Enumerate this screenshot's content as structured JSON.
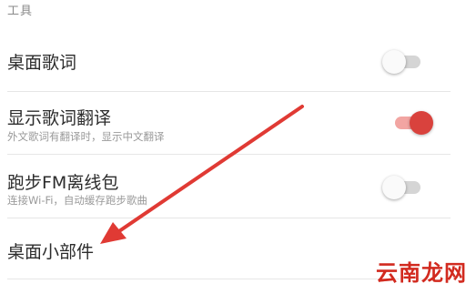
{
  "section": {
    "header": "工具"
  },
  "settings": {
    "desktop_lyrics": {
      "title": "桌面歌词",
      "enabled": false
    },
    "lyrics_translation": {
      "title": "显示歌词翻译",
      "subtitle": "外文歌词有翻译时，显示中文翻译",
      "enabled": true
    },
    "running_fm_offline": {
      "title": "跑步FM离线包",
      "subtitle": "连接Wi-Fi，自动缓存跑步歌曲",
      "enabled": false
    },
    "desktop_widget": {
      "title": "桌面小部件"
    }
  },
  "annotation": {
    "arrow_color": "#e03a34"
  },
  "watermark": {
    "text": "云南龙网"
  },
  "colors": {
    "accent": "#d9423d",
    "accent_track": "#f2a5a2",
    "off_track": "#d5d5d5",
    "title_text": "#2c2c2c",
    "sub_text": "#9a9a9a"
  }
}
